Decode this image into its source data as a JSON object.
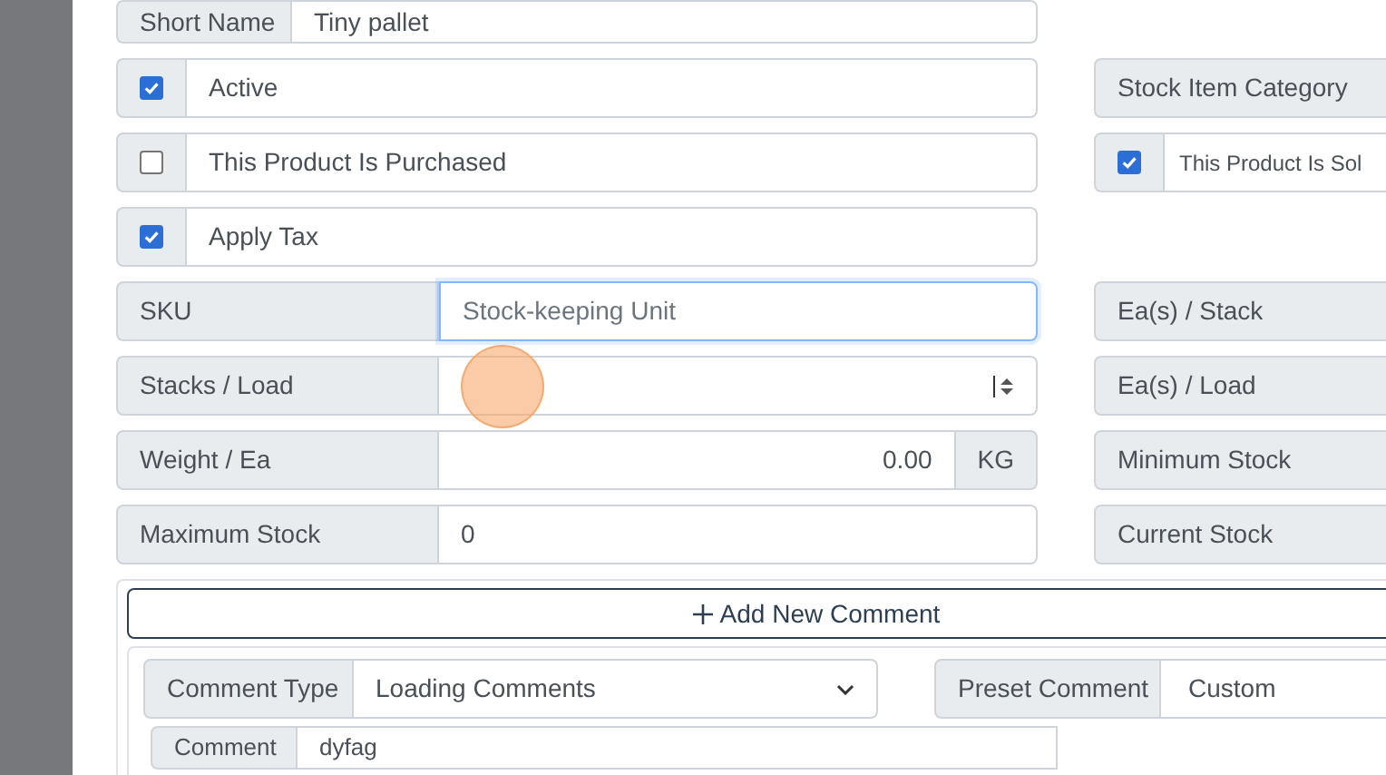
{
  "rows": [
    {
      "left": {
        "kind": "text",
        "label": "Short Name",
        "value": "Tiny pallet"
      }
    },
    {
      "left": {
        "kind": "checkbox",
        "label": "Active",
        "checked": true
      },
      "right": {
        "kind": "label",
        "label": "Stock Item Category"
      }
    },
    {
      "left": {
        "kind": "checkbox",
        "label": "This Product Is Purchased",
        "checked": false
      },
      "right": {
        "kind": "checkbox",
        "label": "This Product Is Sol",
        "checked": true
      }
    },
    {
      "left": {
        "kind": "checkbox",
        "label": "Apply Tax",
        "checked": true
      }
    },
    {
      "left": {
        "kind": "input",
        "label": "SKU",
        "placeholder": "Stock-keeping Unit",
        "focused": true
      },
      "right": {
        "kind": "label",
        "label": "Ea(s) / Stack"
      }
    },
    {
      "left": {
        "kind": "spinner",
        "label": "Stacks / Load"
      },
      "right": {
        "kind": "label",
        "label": "Ea(s) / Load"
      }
    },
    {
      "left": {
        "kind": "unit",
        "label": "Weight / Ea",
        "value": "0.00",
        "unit": "KG"
      },
      "right": {
        "kind": "label",
        "label": "Minimum Stock"
      }
    },
    {
      "left": {
        "kind": "wide",
        "label": "Maximum Stock",
        "value": "0"
      },
      "right": {
        "kind": "label",
        "label": "Current Stock"
      }
    }
  ],
  "comments": {
    "add_button": "Add New Comment",
    "comment_type": {
      "label": "Comment Type",
      "value": "Loading Comments"
    },
    "preset_comment": {
      "label": "Preset Comment",
      "value": "Custom"
    },
    "comment": {
      "label": "Comment",
      "value": "dyfag"
    }
  }
}
